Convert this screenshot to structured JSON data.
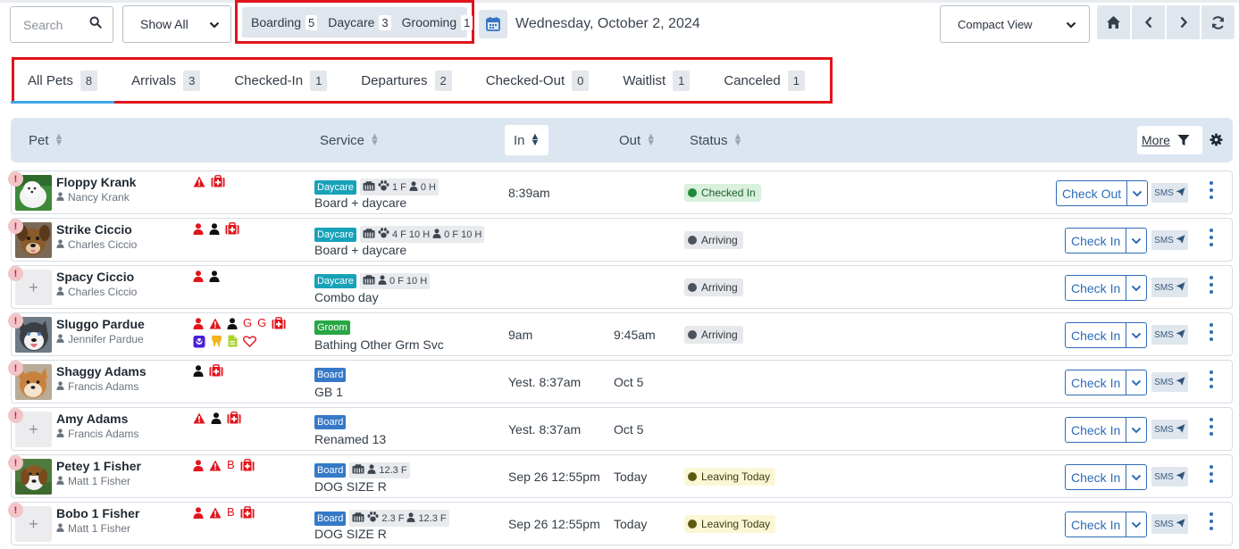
{
  "colors": {
    "accent": "#2d6cb8",
    "alert_red": "#e1141c",
    "daycare": "#17a2b8",
    "groom": "#28a745",
    "board": "#3579c7",
    "checked_in_bg": "#d8f0dc",
    "checked_in_dot": "#1f8a3a",
    "arriving_bg": "#e6e8eb",
    "arriving_dot": "#4b535c",
    "leaving_bg": "#fbf7d6",
    "leaving_dot": "#5d5a12"
  },
  "toolbar": {
    "search_placeholder": "Search",
    "search_icon": "search-icon",
    "filter_value": "Show All",
    "counts": [
      {
        "label": "Boarding",
        "count": "5"
      },
      {
        "label": "Daycare",
        "count": "3"
      },
      {
        "label": "Grooming",
        "count": "1"
      }
    ],
    "date": "Wednesday, October 2, 2024",
    "view_value": "Compact View",
    "nav_icons": [
      "home-icon",
      "chevron-left-icon",
      "chevron-right-icon",
      "refresh-icon"
    ]
  },
  "tabs": [
    {
      "label": "All Pets",
      "count": "8"
    },
    {
      "label": "Arrivals",
      "count": "3"
    },
    {
      "label": "Checked-In",
      "count": "1"
    },
    {
      "label": "Departures",
      "count": "2"
    },
    {
      "label": "Checked-Out",
      "count": "0"
    },
    {
      "label": "Waitlist",
      "count": "1"
    },
    {
      "label": "Canceled",
      "count": "1"
    }
  ],
  "active_tab": "All Pets",
  "columns": {
    "pet": "Pet",
    "service": "Service",
    "in": "In",
    "out": "Out",
    "status": "Status",
    "more": "More"
  },
  "rows": [
    {
      "pet": "Floppy Krank",
      "owner": "Nancy Krank",
      "photo": "white-fluffy-dog",
      "flags": [
        "alert-triangle-icon",
        "medical-kit-icon"
      ],
      "service_tag": "Daycare",
      "service_tag_color": "daycare",
      "capacity": [
        {
          "icon": "crate-icon",
          "text": ""
        },
        {
          "icon": "paw-icon",
          "text": "1 F"
        },
        {
          "icon": "person-icon",
          "text": "0 H"
        }
      ],
      "service_name": "Board + daycare",
      "in": "8:39am",
      "out": "",
      "status": "Checked In",
      "status_style": "checked_in",
      "action": "Check Out",
      "sms": "SMS"
    },
    {
      "pet": "Strike Ciccio",
      "owner": "Charles Ciccio",
      "photo": "brown-dog",
      "flags": [
        "person-red-icon",
        "person-black-icon",
        "medical-kit-icon"
      ],
      "service_tag": "Daycare",
      "service_tag_color": "daycare",
      "capacity": [
        {
          "icon": "crate-icon",
          "text": ""
        },
        {
          "icon": "paw-icon",
          "text": "4 F 10 H"
        },
        {
          "icon": "person-icon",
          "text": "0 F 10 H"
        }
      ],
      "service_name": "Board + daycare",
      "in": "",
      "out": "",
      "status": "Arriving",
      "status_style": "arriving",
      "action": "Check In",
      "sms": "SMS"
    },
    {
      "pet": "Spacy Ciccio",
      "owner": "Charles Ciccio",
      "photo": "",
      "flags": [
        "person-red-icon",
        "person-black-icon"
      ],
      "service_tag": "Daycare",
      "service_tag_color": "daycare",
      "capacity": [
        {
          "icon": "crate-icon",
          "text": ""
        },
        {
          "icon": "person-icon",
          "text": "0 F 10 H"
        }
      ],
      "service_name": "Combo day",
      "in": "",
      "out": "",
      "status": "Arriving",
      "status_style": "arriving",
      "action": "Check In",
      "sms": "SMS"
    },
    {
      "pet": "Sluggo Pardue",
      "owner": "Jennifer Pardue",
      "photo": "husky-dog",
      "flags": [
        "person-red-icon",
        "alert-triangle-icon",
        "person-black-icon",
        "G",
        "G",
        "medical-kit-icon",
        "bag-icon",
        "tooth-icon",
        "document-icon",
        "heart-icon"
      ],
      "service_tag": "Groom",
      "service_tag_color": "groom",
      "capacity": [],
      "service_name": "Bathing Other Grm Svc",
      "in": "9am",
      "out": "9:45am",
      "status": "Arriving",
      "status_style": "arriving",
      "action": "Check In",
      "sms": "SMS"
    },
    {
      "pet": "Shaggy Adams",
      "owner": "Francis Adams",
      "photo": "shiba-dog",
      "flags": [
        "person-black-icon",
        "medical-kit-icon"
      ],
      "service_tag": "Board",
      "service_tag_color": "board",
      "capacity": [],
      "service_name": "GB 1",
      "in": "Yest. 8:37am",
      "out": "Oct 5",
      "status": "",
      "status_style": "",
      "action": "Check In",
      "sms": "SMS"
    },
    {
      "pet": "Amy Adams",
      "owner": "Francis Adams",
      "photo": "",
      "flags": [
        "alert-triangle-icon",
        "person-black-icon",
        "medical-kit-icon"
      ],
      "service_tag": "Board",
      "service_tag_color": "board",
      "capacity": [],
      "service_name": "Renamed 13",
      "in": "Yest. 8:37am",
      "out": "Oct 5",
      "status": "",
      "status_style": "",
      "action": "Check In",
      "sms": "SMS"
    },
    {
      "pet": "Petey 1 Fisher",
      "owner": "Matt 1 Fisher",
      "photo": "beagle-dog",
      "flags": [
        "person-red-icon",
        "alert-triangle-icon",
        "B",
        "medical-kit-icon"
      ],
      "service_tag": "Board",
      "service_tag_color": "board",
      "capacity": [
        {
          "icon": "crate-icon",
          "text": ""
        },
        {
          "icon": "person-icon",
          "text": "12.3 F"
        }
      ],
      "service_name": "DOG SIZE R",
      "in": "Sep 26 12:55pm",
      "out": "Today",
      "status": "Leaving Today",
      "status_style": "leaving",
      "action": "Check In",
      "sms": "SMS"
    },
    {
      "pet": "Bobo 1 Fisher",
      "owner": "Matt 1 Fisher",
      "photo": "",
      "flags": [
        "person-red-icon",
        "alert-triangle-icon",
        "B",
        "medical-kit-icon"
      ],
      "service_tag": "Board",
      "service_tag_color": "board",
      "capacity": [
        {
          "icon": "crate-icon",
          "text": ""
        },
        {
          "icon": "paw-icon",
          "text": "2.3 F"
        },
        {
          "icon": "person-icon",
          "text": "12.3 F"
        }
      ],
      "service_name": "DOG SIZE R",
      "in": "Sep 26 12:55pm",
      "out": "Today",
      "status": "Leaving Today",
      "status_style": "leaving",
      "action": "Check In",
      "sms": "SMS"
    }
  ]
}
